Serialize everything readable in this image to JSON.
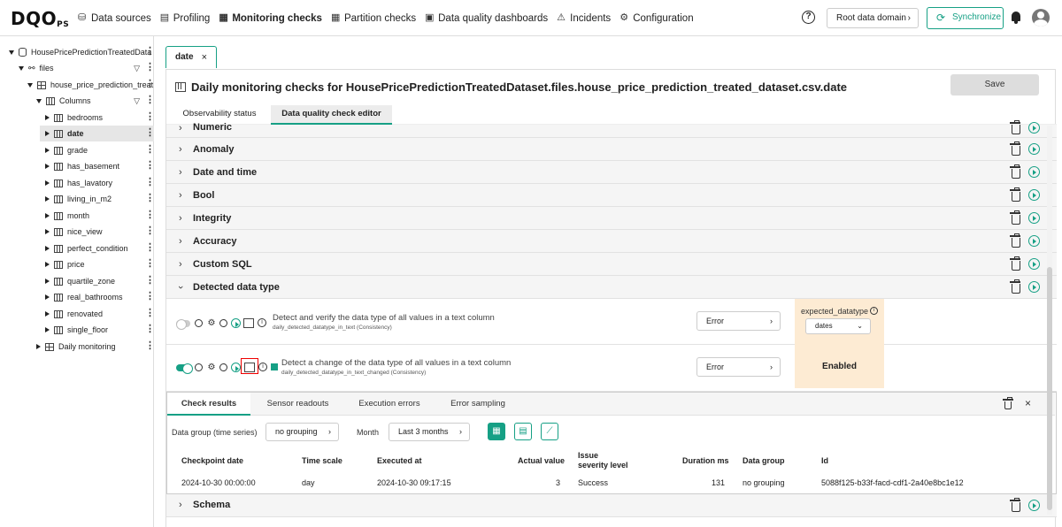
{
  "app": {
    "logo_main": "DQO",
    "logo_sub": "PS"
  },
  "nav": [
    {
      "label": "Data sources",
      "icon": "data-sources-icon"
    },
    {
      "label": "Profiling",
      "icon": "profiling-icon"
    },
    {
      "label": "Monitoring checks",
      "icon": "monitoring-icon",
      "active": true
    },
    {
      "label": "Partition checks",
      "icon": "partition-icon"
    },
    {
      "label": "Data quality dashboards",
      "icon": "dashboard-icon"
    },
    {
      "label": "Incidents",
      "icon": "warning-icon"
    },
    {
      "label": "Configuration",
      "icon": "gear-icon"
    }
  ],
  "header_right": {
    "help": "?",
    "domain_label": "Root data domain",
    "sync_label": "Synchronize"
  },
  "tree": {
    "connection": "HousePricePredictionTreatedData",
    "schema": "files",
    "table": "house_price_prediction_treat",
    "columns_label": "Columns",
    "columns": [
      "bedrooms",
      "date",
      "grade",
      "has_basement",
      "has_lavatory",
      "living_in_m2",
      "month",
      "nice_view",
      "perfect_condition",
      "price",
      "quartile_zone",
      "real_bathrooms",
      "renovated",
      "single_floor"
    ],
    "selected": "date",
    "monitoring": "Daily monitoring"
  },
  "tab": {
    "label": "date",
    "close": "×"
  },
  "panel": {
    "title": "Daily monitoring checks for HousePricePredictionTreatedDataset.files.house_price_prediction_treated_dataset.csv.date",
    "save_label": "Save",
    "subtabs": [
      "Observability status",
      "Data quality check editor"
    ]
  },
  "categories": [
    "Numeric",
    "Anomaly",
    "Date and time",
    "Bool",
    "Integrity",
    "Accuracy",
    "Custom SQL",
    "Detected data type"
  ],
  "checks": [
    {
      "title": "Detect and verify the data type of all values in a text column",
      "subtitle": "daily_detected_datatype_in_text (Consistency)",
      "severity": "Error",
      "rule_label": "expected_datatype",
      "rule_value": "dates"
    },
    {
      "title": "Detect a change of the data type of all values in a text column",
      "subtitle": "daily_detected_datatype_in_text_changed (Consistency)",
      "severity": "Error",
      "rule_value": "Enabled"
    }
  ],
  "results": {
    "tabs": [
      "Check results",
      "Sensor readouts",
      "Execution errors",
      "Error sampling"
    ],
    "group_label": "Data group (time series)",
    "group_value": "no grouping",
    "month_label": "Month",
    "month_value": "Last 3 months",
    "columns": [
      "Checkpoint date",
      "Time scale",
      "Executed at",
      "Actual value",
      "Issue",
      "severity level",
      "Duration ms",
      "Data group",
      "Id"
    ],
    "rows": [
      {
        "checkpoint": "2024-10-30 00:00:00",
        "scale": "day",
        "executed": "2024-10-30 09:17:15",
        "actual": "3",
        "severity": "Success",
        "duration": "131",
        "group": "no grouping",
        "id": "5088f125-b33f-facd-cdf1-2a40e8bc1e12"
      }
    ]
  },
  "schema_label": "Schema",
  "colors": {
    "accent": "#16a085",
    "rule_bg": "#fdebd3",
    "highlight": "#e00000"
  }
}
